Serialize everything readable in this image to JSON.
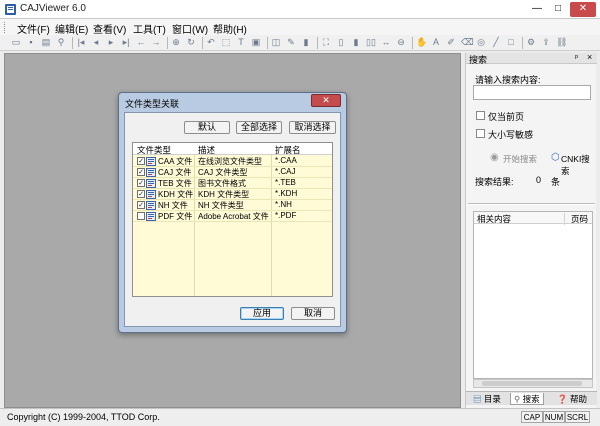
{
  "window": {
    "title": "CAJViewer 6.0",
    "min": "—",
    "max": "□",
    "close": "✕"
  },
  "menu": [
    {
      "label": "文件(F)"
    },
    {
      "label": "编辑(E)"
    },
    {
      "label": "查看(V)"
    },
    {
      "label": "工具(T)"
    },
    {
      "label": "窗口(W)"
    },
    {
      "label": "帮助(H)"
    }
  ],
  "toolbar": {
    "icons": [
      "open-icon",
      "save-icon",
      "print-icon",
      "find-icon",
      "first-page-icon",
      "prev-page-icon",
      "next-page-icon",
      "last-page-icon",
      "back-icon",
      "forward-icon",
      "zoom-icon",
      "rotate-icon",
      "undo-icon",
      "select-icon",
      "text-select-icon",
      "image-select-icon",
      "snapshot-icon",
      "note-icon",
      "highlight-icon",
      "fullscreen-icon",
      "single-page-icon",
      "continuous-icon",
      "facing-icon",
      "fit-width-icon",
      "zoom-out-icon",
      "hand-icon",
      "text-tool-icon",
      "pen-icon",
      "eraser-icon",
      "stamp-icon",
      "line-icon",
      "rect-icon",
      "settings-icon",
      "export-icon",
      "link-icon"
    ]
  },
  "search_panel": {
    "title": "搜索",
    "pin": "ᵖ",
    "close": "×",
    "prompt": "请输入搜索内容:",
    "input_value": "",
    "current_page_only": {
      "label": "仅当前页",
      "checked": false
    },
    "case_sensitive": {
      "label": "大小写敏感",
      "checked": false
    },
    "start_search": "开始搜索",
    "cnki_search": "CNKI搜索",
    "results_label": "搜索结果:",
    "results_count": "0",
    "results_unit": "条",
    "list_headers": {
      "content": "相关内容",
      "page": "页码"
    },
    "tabs": [
      {
        "label": "目录",
        "active": false
      },
      {
        "label": "搜索",
        "active": true
      },
      {
        "label": "帮助",
        "active": false
      }
    ]
  },
  "dialog": {
    "title": "文件类型关联",
    "close": "✕",
    "buttons": {
      "default": "默认",
      "select_all": "全部选择",
      "deselect": "取消选择",
      "apply": "应用",
      "cancel": "取消"
    },
    "headers": {
      "type": "文件类型",
      "desc": "描述",
      "ext": "扩展名"
    },
    "rows": [
      {
        "type": "CAA 文件",
        "desc": "在线浏览文件类型",
        "ext": "*.CAA",
        "checked": true,
        "mark": "✓"
      },
      {
        "type": "CAJ 文件",
        "desc": "CAJ 文件类型",
        "ext": "*.CAJ",
        "checked": true,
        "mark": "✓"
      },
      {
        "type": "TEB 文件",
        "desc": "图书文件格式",
        "ext": "*.TEB",
        "checked": true,
        "mark": "✓"
      },
      {
        "type": "KDH 文件",
        "desc": "KDH 文件类型",
        "ext": "*.KDH",
        "checked": true,
        "mark": "✓"
      },
      {
        "type": "NH 文件",
        "desc": "NH 文件类型",
        "ext": "*.NH",
        "checked": true,
        "mark": "✓"
      },
      {
        "type": "PDF 文件",
        "desc": "Adobe Acrobat 文件",
        "ext": "*.PDF",
        "checked": false,
        "mark": ""
      }
    ]
  },
  "status": {
    "copyright": "Copyright (C) 1999-2004, TTOD Corp.",
    "indicators": [
      "CAP",
      "NUM",
      "SCRL"
    ]
  },
  "colors": {
    "dialog_frame": "#b9cbe2",
    "grid_background": "#fffbd6",
    "workspace": "#a9a9a9",
    "close_red": "#c94a4a"
  }
}
